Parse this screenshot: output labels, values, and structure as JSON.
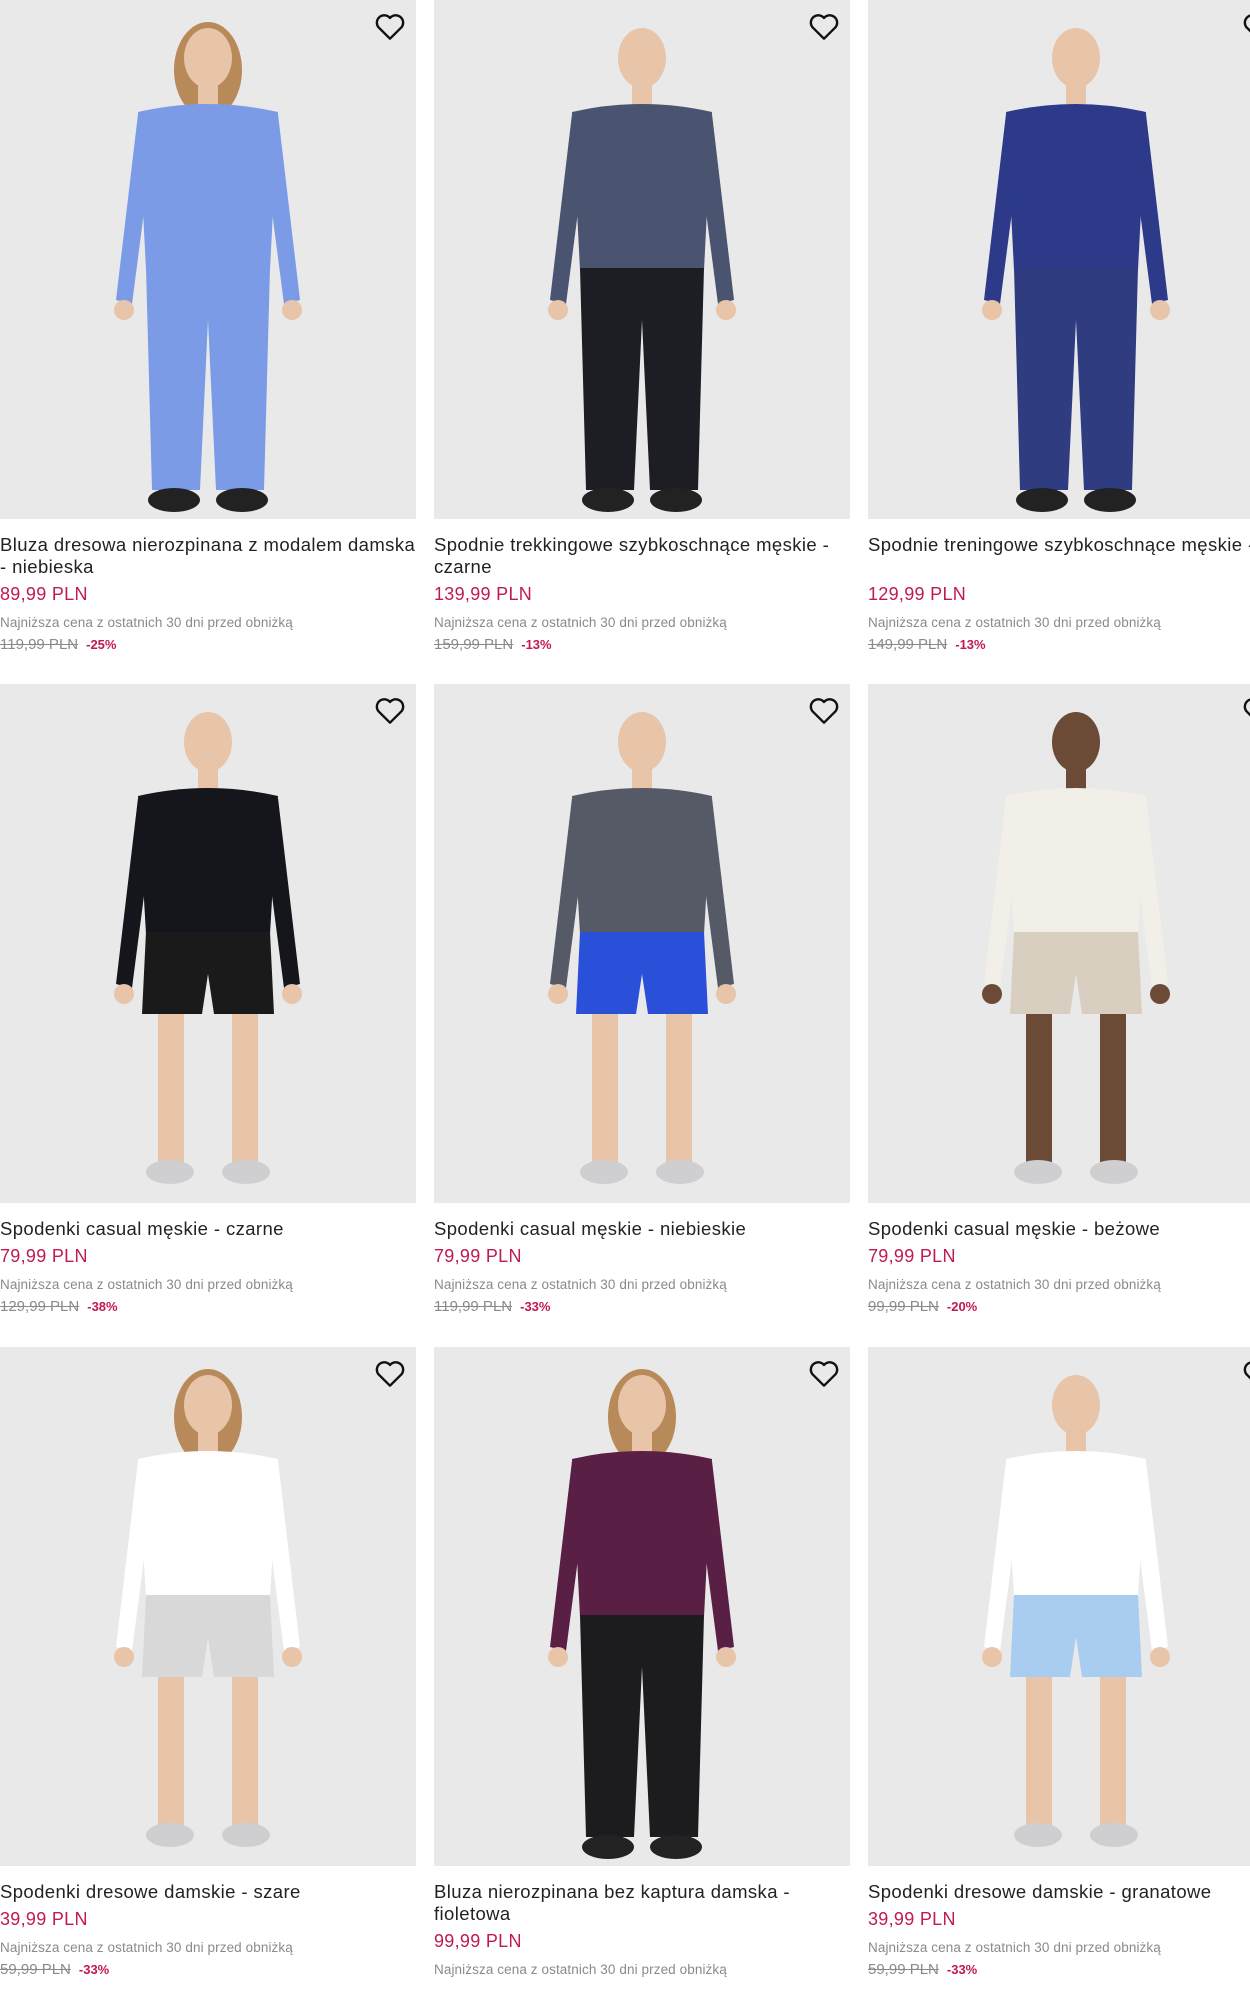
{
  "products": [
    {
      "name": "Bluza dresowa nierozpinana z modalem damska - niebieska",
      "price": "89,99 PLN",
      "lowest_label": "Najniższa cena z ostatnich 30 dni przed obniżką",
      "old_price": "119,99 PLN",
      "discount": "-25%",
      "garment_top": "#7b9be6",
      "garment_bottom": "#7b9be6"
    },
    {
      "name": "Spodnie trekkingowe szybkoschnące męskie - czarne",
      "price": "139,99 PLN",
      "lowest_label": "Najniższa cena z ostatnich 30 dni przed obniżką",
      "old_price": "159,99 PLN",
      "discount": "-13%",
      "garment_top": "#4a5470",
      "garment_bottom": "#1c1e24"
    },
    {
      "name": "Spodnie treningowe szybkoschnące męskie - granatowe",
      "price": "129,99 PLN",
      "lowest_label": "Najniższa cena z ostatnich 30 dni przed obniżką",
      "old_price": "149,99 PLN",
      "discount": "-13%",
      "garment_top": "#2d3a8a",
      "garment_bottom": "#2f3d80"
    },
    {
      "name": "Spodenki casual męskie - czarne",
      "price": "79,99 PLN",
      "lowest_label": "Najniższa cena z ostatnich 30 dni przed obniżką",
      "old_price": "129,99 PLN",
      "discount": "-38%",
      "garment_top": "#14161c",
      "garment_bottom": "#1a1a1a"
    },
    {
      "name": "Spodenki casual męskie - niebieskie",
      "price": "79,99 PLN",
      "lowest_label": "Najniższa cena z ostatnich 30 dni przed obniżką",
      "old_price": "119,99 PLN",
      "discount": "-33%",
      "garment_top": "#555a66",
      "garment_bottom": "#2a4fd8"
    },
    {
      "name": "Spodenki casual męskie - beżowe",
      "price": "79,99 PLN",
      "lowest_label": "Najniższa cena z ostatnich 30 dni przed obniżką",
      "old_price": "99,99 PLN",
      "discount": "-20%",
      "garment_top": "#f2efe8",
      "garment_bottom": "#d9cfc0"
    },
    {
      "name": "Spodenki dresowe damskie - szare",
      "price": "39,99 PLN",
      "lowest_label": "Najniższa cena z ostatnich 30 dni przed obniżką",
      "old_price": "59,99 PLN",
      "discount": "-33%",
      "garment_top": "#ffffff",
      "garment_bottom": "#d8d8d8"
    },
    {
      "name": "Bluza nierozpinana bez kaptura damska - fioletowa",
      "price": "99,99 PLN",
      "lowest_label": "Najniższa cena z ostatnich 30 dni przed obniżką",
      "old_price": "",
      "discount": "",
      "garment_top": "#5a1f45",
      "garment_bottom": "#1c1c1e"
    },
    {
      "name": "Spodenki dresowe damskie - granatowe",
      "price": "39,99 PLN",
      "lowest_label": "Najniższa cena z ostatnich 30 dni przed obniżką",
      "old_price": "59,99 PLN",
      "discount": "-33%",
      "garment_top": "#ffffff",
      "garment_bottom": "#a9cdf0"
    }
  ]
}
